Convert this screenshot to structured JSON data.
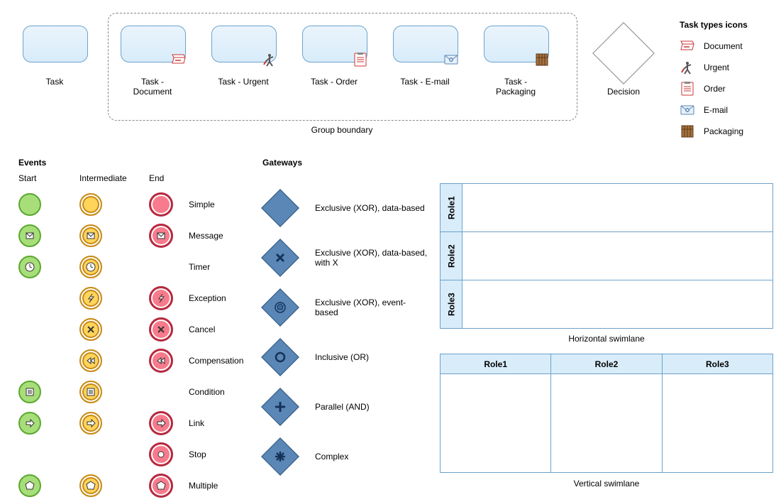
{
  "tasks": {
    "plain_label": "Task",
    "group_label": "Group boundary",
    "items": [
      {
        "label": "Task - Document",
        "icon": "document-icon"
      },
      {
        "label": "Task - Urgent",
        "icon": "urgent-icon"
      },
      {
        "label": "Task - Order",
        "icon": "order-icon"
      },
      {
        "label": "Task - E-mail",
        "icon": "email-icon"
      },
      {
        "label": "Task - Packaging",
        "icon": "packaging-icon"
      }
    ]
  },
  "decision_label": "Decision",
  "tasktypes": {
    "heading": "Task types icons",
    "items": [
      {
        "label": "Document",
        "icon": "document-icon"
      },
      {
        "label": "Urgent",
        "icon": "urgent-icon"
      },
      {
        "label": "Order",
        "icon": "order-icon"
      },
      {
        "label": "E-mail",
        "icon": "email-icon"
      },
      {
        "label": "Packaging",
        "icon": "packaging-icon"
      }
    ]
  },
  "events": {
    "heading": "Events",
    "cols": {
      "start": "Start",
      "intermediate": "Intermediate",
      "end": "End"
    },
    "rows": [
      {
        "label": "Simple",
        "start": true,
        "inter": true,
        "end": true,
        "glyph": "none"
      },
      {
        "label": "Message",
        "start": true,
        "inter": true,
        "end": true,
        "glyph": "envelope"
      },
      {
        "label": "Timer",
        "start": true,
        "inter": true,
        "end": false,
        "glyph": "clock"
      },
      {
        "label": "Exception",
        "start": false,
        "inter": true,
        "end": true,
        "glyph": "bolt"
      },
      {
        "label": "Cancel",
        "start": false,
        "inter": true,
        "end": true,
        "glyph": "x"
      },
      {
        "label": "Compensation",
        "start": false,
        "inter": true,
        "end": true,
        "glyph": "rewind"
      },
      {
        "label": "Condition",
        "start": true,
        "inter": true,
        "end": false,
        "glyph": "list"
      },
      {
        "label": "Link",
        "start": true,
        "inter": true,
        "end": true,
        "glyph": "arrow"
      },
      {
        "label": "Stop",
        "start": false,
        "inter": false,
        "end": true,
        "glyph": "dot"
      },
      {
        "label": "Multiple",
        "start": true,
        "inter": true,
        "end": true,
        "glyph": "pentagon"
      }
    ]
  },
  "gateways": {
    "heading": "Gateways",
    "items": [
      {
        "label": "Exclusive (XOR), data-based",
        "glyph": "blank"
      },
      {
        "label": "Exclusive (XOR), data-based, with X",
        "glyph": "x"
      },
      {
        "label": "Exclusive (XOR), event-based",
        "glyph": "pentagon-ring"
      },
      {
        "label": "Inclusive (OR)",
        "glyph": "ring"
      },
      {
        "label": "Parallel (AND)",
        "glyph": "plus"
      },
      {
        "label": "Complex",
        "glyph": "asterisk"
      }
    ]
  },
  "swimlanes": {
    "horizontal": {
      "label": "Horizontal swimlane",
      "roles": [
        "Role1",
        "Role2",
        "Role3"
      ]
    },
    "vertical": {
      "label": "Vertical swimlane",
      "roles": [
        "Role1",
        "Role2",
        "Role3"
      ]
    }
  }
}
